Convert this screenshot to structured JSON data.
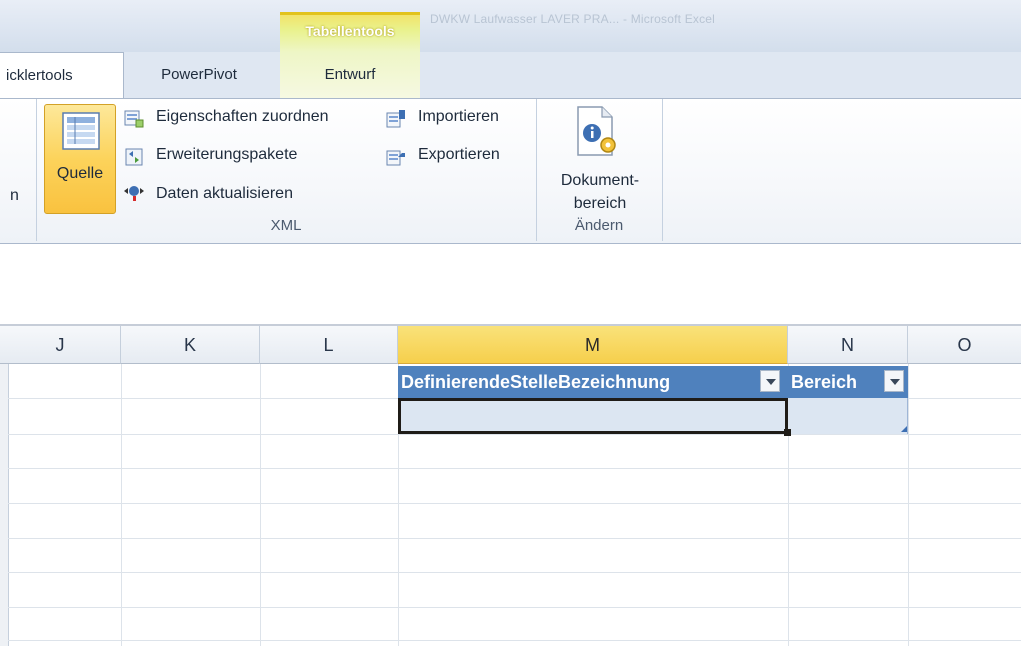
{
  "title_bar": {
    "context_group_label": "Tabellentools",
    "window_title": "DWKW Laufwasser LAVER PRA... - Microsoft Excel"
  },
  "tabs": [
    {
      "label": "icklertools",
      "active": true
    },
    {
      "label": "PowerPivot",
      "active": false
    },
    {
      "label": "Entwurf",
      "active": false
    }
  ],
  "ribbon": {
    "partial_left_label": "n",
    "xml_group": {
      "label": "XML",
      "source_button": "Quelle",
      "commands": [
        {
          "label": "Eigenschaften zuordnen",
          "icon": "map-properties-icon"
        },
        {
          "label": "Erweiterungspakete",
          "icon": "expansion-packs-icon"
        },
        {
          "label": "Daten aktualisieren",
          "icon": "refresh-data-icon"
        },
        {
          "label": "Importieren",
          "icon": "import-icon"
        },
        {
          "label": "Exportieren",
          "icon": "export-icon"
        }
      ]
    },
    "modify_group": {
      "label": "Ändern",
      "doc_button_line1": "Dokument-",
      "doc_button_line2": "bereich"
    }
  },
  "grid": {
    "columns": [
      "J",
      "K",
      "L",
      "M",
      "N",
      "O"
    ],
    "selected_column": "M",
    "table_headers": [
      "DefinierendeStelleBezeichnung",
      "Bereich"
    ]
  },
  "colors": {
    "table_header": "#4f81bd",
    "selected_column_header": "#f6cf4c",
    "context_tab": "#e9f28d"
  }
}
